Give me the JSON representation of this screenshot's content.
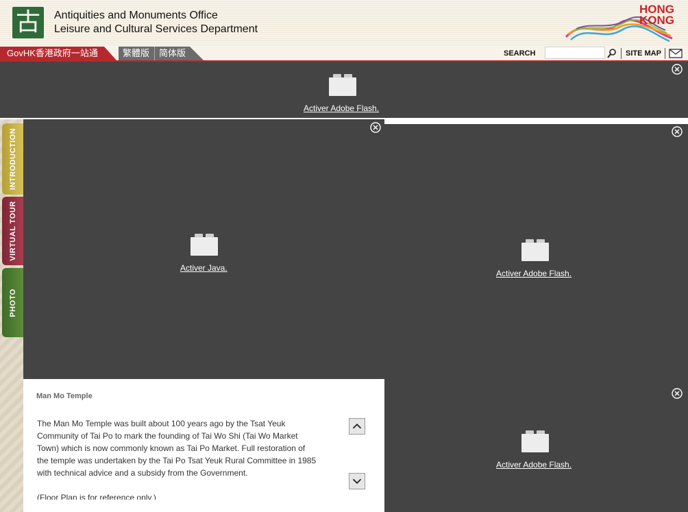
{
  "header": {
    "logo_glyph": "古",
    "org_line1": "Antiquities and Monuments Office",
    "org_line2": "Leisure and Cultural Services Department",
    "brand_text_line1": "HONG",
    "brand_text_line2": "KONG"
  },
  "nav": {
    "govhk": "GovHK香港政府一站通",
    "lang_traditional": "繁體版",
    "lang_simplified": "简体版",
    "search_label": "SEARCH",
    "search_value": "",
    "site_map": "SITE MAP"
  },
  "plugins": {
    "top_flash": "Activer Adobe Flash.",
    "java": "Activer Java.",
    "right_flash_1": "Activer Adobe Flash.",
    "right_flash_2": "Activer Adobe Flash."
  },
  "side_tabs": [
    {
      "label": "INTRODUCTION"
    },
    {
      "label": "VIRTUAL TOUR"
    },
    {
      "label": "PHOTO"
    }
  ],
  "info": {
    "title": "Man Mo Temple",
    "paragraph1": "The Man Mo Temple was built about 100 years ago by the Tsat Yeuk Community of Tai Po to mark the founding of Tai Wo Shi (Tai Wo Market Town) which is now commonly known as Tai Po Market. Full restoration of the temple was undertaken by the Tai Po Tsat Yeuk Rural Committee in 1985 with technical advice and a subsidy from the Government.",
    "paragraph2": "(Floor Plan is for reference only.)"
  },
  "colors": {
    "header_bg": "#f7f3ea",
    "govhk_red": "#b5292e",
    "panel_dark": "#444444",
    "brand_red": "#c7252d"
  },
  "icons": [
    "close-icon",
    "search-icon",
    "mail-icon",
    "plugin-block-icon",
    "arrow-up-icon",
    "arrow-down-icon"
  ]
}
